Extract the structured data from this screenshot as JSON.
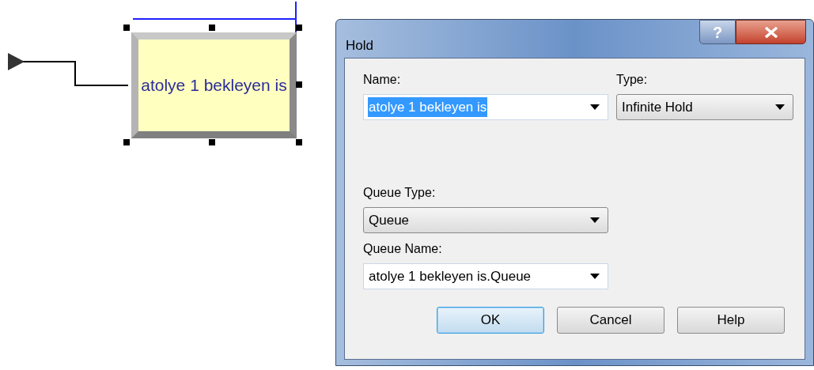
{
  "diagram": {
    "module": {
      "label": "atolye 1 bekleyen is",
      "selected": true
    }
  },
  "dialog": {
    "title": "Hold",
    "help_glyph": "?",
    "fields": [
      {
        "label": "Name:",
        "value": "atolye 1 bekleyen is",
        "kind": "editable",
        "text_selected": true
      },
      {
        "label": "Type:",
        "value": "Infinite Hold",
        "kind": "list",
        "text_selected": false
      },
      {
        "label": "Queue Type:",
        "value": "Queue",
        "kind": "list",
        "text_selected": false
      },
      {
        "label": "Queue Name:",
        "value": "atolye 1 bekleyen is.Queue",
        "kind": "editable",
        "text_selected": false
      }
    ],
    "buttons": [
      {
        "label": "OK",
        "default": true
      },
      {
        "label": "Cancel",
        "default": false
      },
      {
        "label": "Help",
        "default": false
      }
    ]
  }
}
